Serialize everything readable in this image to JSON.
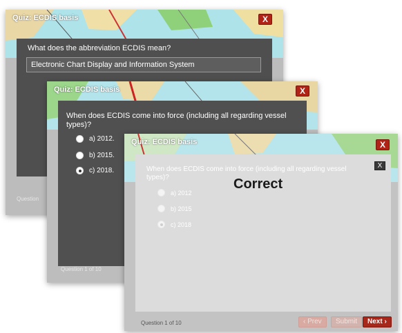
{
  "windows": [
    {
      "title": "Quiz: ECDIS basis",
      "close_label": "X",
      "question": "What does the abbreviation ECDIS mean?",
      "answer_value": "Electronic Chart Display and Information System",
      "footer": "Question"
    },
    {
      "title": "Quiz: ECDIS basis",
      "close_label": "X",
      "question": "When does ECDIS come into force (including all regarding vessel types)?",
      "options": [
        "a) 2012.",
        "b) 2015.",
        "c) 2018."
      ],
      "selected_option": 2,
      "footer": "Question 1 of 10"
    },
    {
      "title": "Quiz: ECDIS basis",
      "close_label": "X",
      "question": "When does ECDIS come into force (including all regarding vessel types)?",
      "options": [
        "a) 2012",
        "b) 2015",
        "c) 2018"
      ],
      "selected_option": 2,
      "feedback_close_label": "X",
      "feedback": "Correct",
      "footer": "Question 1 of 10",
      "prev_label": "Prev",
      "submit_label": "Submit",
      "next_label": "Next"
    }
  ],
  "colors": {
    "close_red": "#b02418",
    "next_red": "#a8271b",
    "panel_dark": "#4f4f4f",
    "panel_light": "#dcdcdc"
  }
}
